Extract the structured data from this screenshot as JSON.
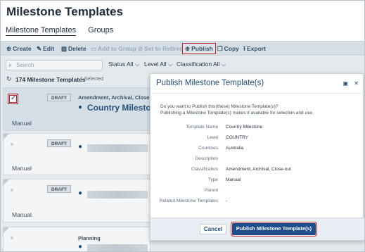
{
  "page": {
    "title": "Milestone Templates"
  },
  "tabs": [
    {
      "label": "Milestone Templates",
      "active": true
    },
    {
      "label": "Groups",
      "active": false
    }
  ],
  "toolbar": {
    "create": "Create",
    "edit": "Edit",
    "delete": "Delete",
    "add_to_group": "Add to Group",
    "set_to_retired": "Set to Retired",
    "publish": "Publish",
    "copy": "Copy",
    "export": "Export"
  },
  "filters": {
    "search_placeholder": "Search",
    "status": "Status All",
    "level": "Level All",
    "classification": "Classification All"
  },
  "list": {
    "count_label": "174 Milestone Templates",
    "selected_label": "1 Selected"
  },
  "cards": [
    {
      "status": "DRAFT",
      "classification": "Amendment, Archival, Close-out",
      "name": "Country Milestone",
      "type": "Manual",
      "selected": true
    },
    {
      "status": "DRAFT",
      "classification": "",
      "name": "",
      "type": "Manual",
      "selected": false
    },
    {
      "status": "DRAFT",
      "classification": "",
      "name": "",
      "type": "Manual",
      "selected": false
    },
    {
      "status": "",
      "classification": "Planning",
      "name": "",
      "type": "",
      "selected": false
    }
  ],
  "modal": {
    "title": "Publish Milestone Template(s)",
    "message_line1": "Do you want to Publish this(these) Milestone Template(s)?",
    "message_line2": "Publishing a Milestone Template(s) makes it available for selection and use.",
    "fields": [
      {
        "label": "Template Name",
        "value": "Country Milestone"
      },
      {
        "label": "Level",
        "value": "COUNTRY"
      },
      {
        "label": "Countries",
        "value": "Australia"
      },
      {
        "label": "Description",
        "value": ""
      },
      {
        "label": "Classification",
        "value": "Amendment, Archival, Close-out"
      },
      {
        "label": "Type",
        "value": "Manual"
      },
      {
        "label": "Parent",
        "value": ""
      },
      {
        "label": "Related Milestone Templates",
        "value": "-"
      }
    ],
    "cancel_label": "Cancel",
    "publish_label": "Publish Milestone Template(s)"
  },
  "colors": {
    "accent": "#1f4d8c",
    "highlight": "#c0202a",
    "toolbar_bg": "#dfe6ed"
  },
  "icons": {
    "create": "plus-circle-icon",
    "edit": "pencil-icon",
    "delete": "trash-icon",
    "add_to_group": "folder-icon",
    "set_to_retired": "ban-icon",
    "publish": "publish-icon",
    "copy": "copy-icon",
    "export": "export-icon",
    "refresh": "refresh-icon",
    "location": "map-pin-icon"
  }
}
